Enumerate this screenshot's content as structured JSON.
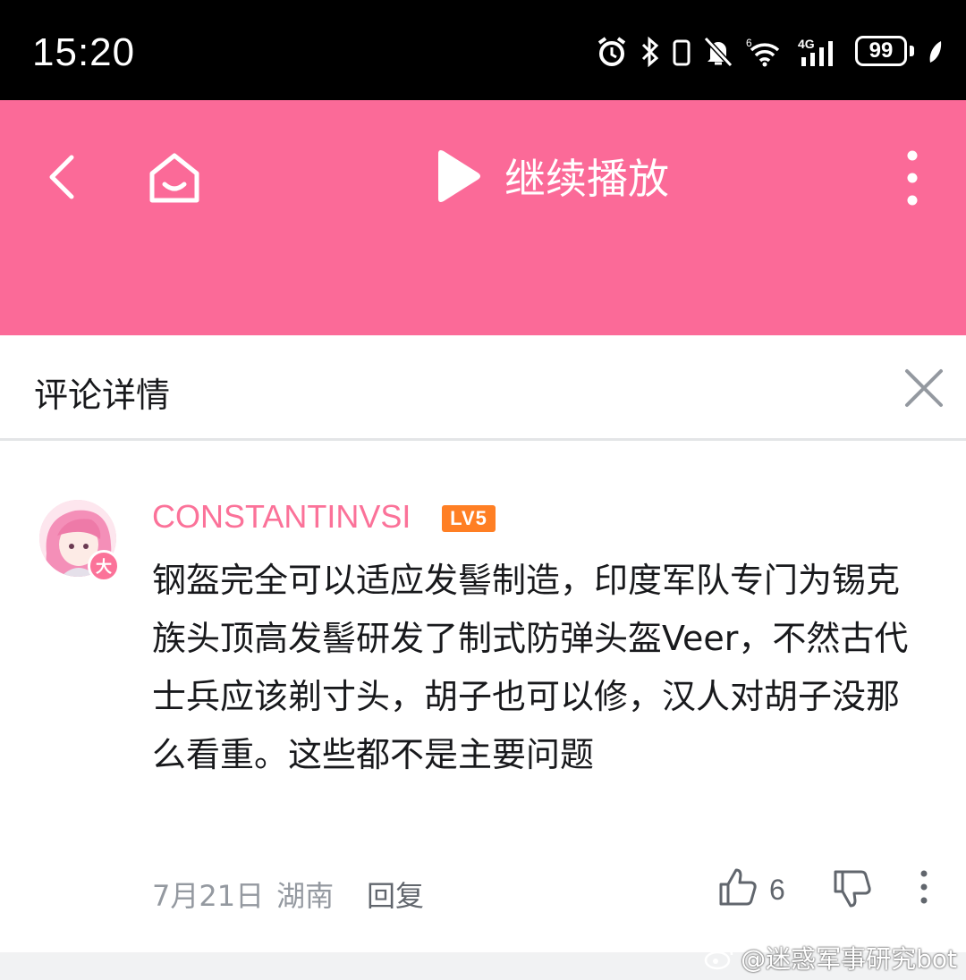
{
  "status_bar": {
    "time": "15:20",
    "battery": "99",
    "icons": [
      "alarm-icon",
      "bluetooth-icon",
      "vibrate-icon",
      "mute-bell-icon",
      "wifi-6-icon",
      "signal-4g-icon",
      "battery-icon",
      "leaf-icon"
    ]
  },
  "topbar": {
    "play_label": "继续播放",
    "background": "#fb6a98"
  },
  "panel": {
    "title": "评论详情"
  },
  "comment": {
    "username": "CONSTANTINVSI",
    "level": "LV5",
    "avatar_badge": "大",
    "text": "钢盔完全可以适应发髻制造，印度军队专门为锡克族头顶高发髻研发了制式防弹头盔Veer，不然古代士兵应该剃寸头，胡子也可以修，汉人对胡子没那么看重。这些都不是主要问题",
    "date": "7月21日",
    "location": "湖南",
    "reply_label": "回复",
    "likes": "6",
    "username_color": "#fb7299"
  },
  "watermark": {
    "text": "@迷惑军事研究bot"
  }
}
